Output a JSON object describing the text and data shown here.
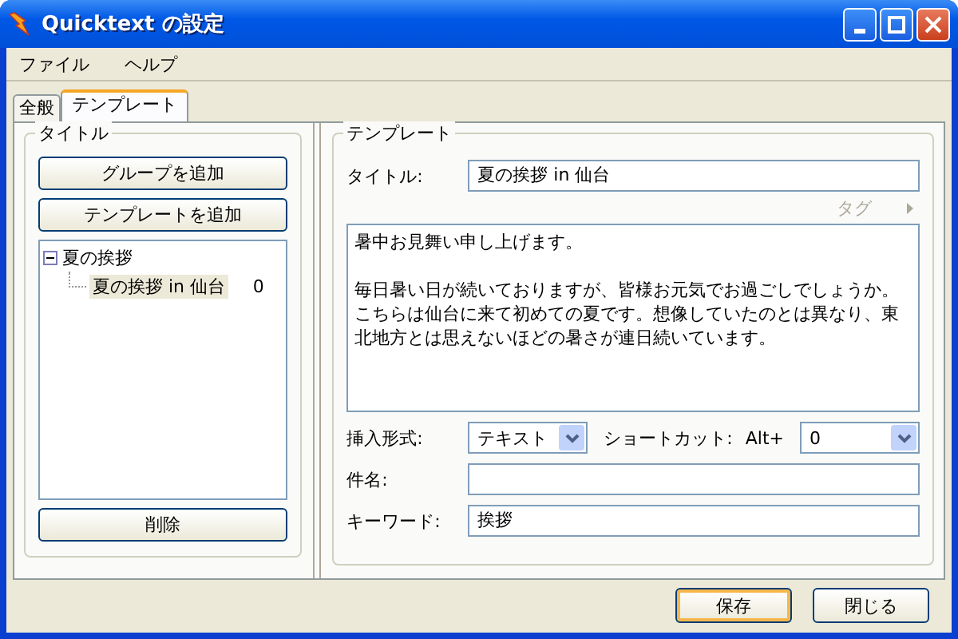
{
  "window": {
    "title": "Quicktext の設定"
  },
  "menu": [
    {
      "label": "ファイル"
    },
    {
      "label": "ヘルプ"
    }
  ],
  "tabs": [
    {
      "label": "全般",
      "selected": false
    },
    {
      "label": "テンプレート",
      "selected": true
    }
  ],
  "left_panel": {
    "group_title": "タイトル",
    "buttons": [
      "グループを追加",
      "テンプレートを追加"
    ],
    "tree": [
      {
        "label": "夏の挨拶",
        "expanded": true,
        "children": [
          {
            "label": "夏の挨拶 in 仙台",
            "count": "0",
            "selected": true
          }
        ]
      }
    ],
    "delete_button": "削除"
  },
  "right_panel": {
    "group_title": "テンプレート",
    "title_label": "タイトル:",
    "title_value": "夏の挨拶 in 仙台",
    "tag_label": "タグ",
    "body": [
      "暑中お見舞い申し上げます。",
      "毎日暑い日が続いておりますが、皆様お元気でお過ごしでしょうか。こちらは仙台に来て初めての夏です。想像していたのとは異なり、東北地方とは思えないほどの暑さが連日続いています。"
    ],
    "insert_label": "挿入形式:",
    "insert_value": "テキスト",
    "shortcut_label": "ショートカット:",
    "shortcut_prefix": "Alt+",
    "shortcut_value": "0",
    "subject_label": "件名:",
    "keyword_label": "キーワード:",
    "keyword_value": "挨拶"
  },
  "footer_buttons": [
    {
      "label": "保存",
      "default": true
    },
    {
      "label": "閉じる",
      "default": false
    }
  ]
}
